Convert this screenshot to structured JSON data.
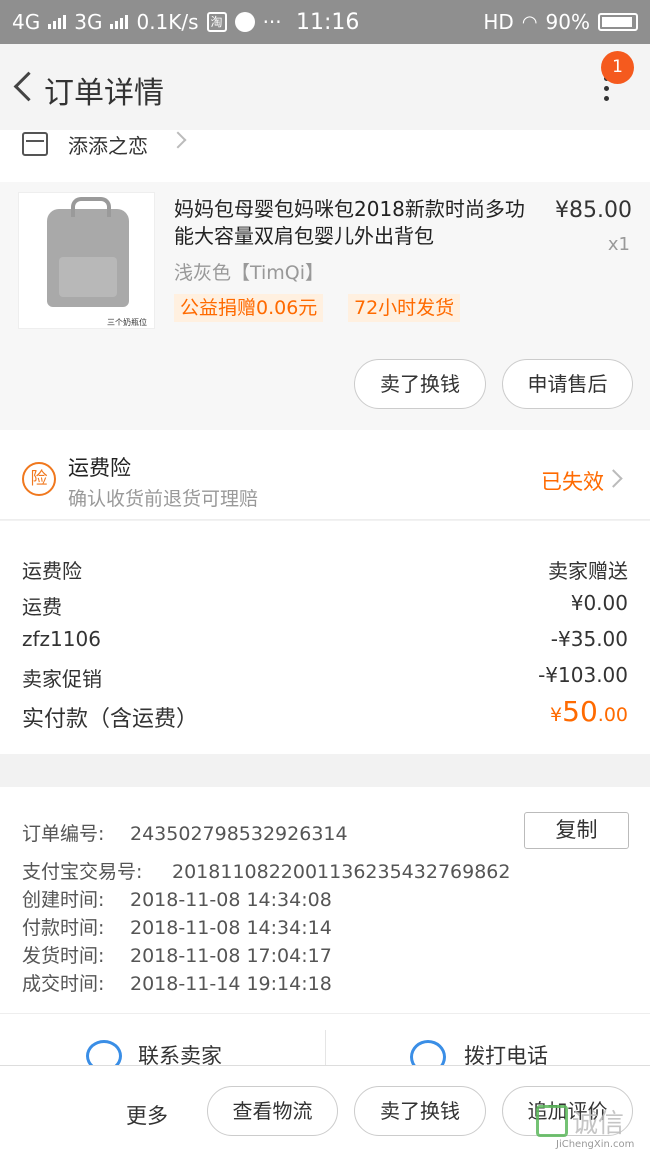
{
  "status_bar": {
    "network1": "4G",
    "network2": "3G",
    "speed": "0.1K/s",
    "taobao_glyph": "淘",
    "dots": "···",
    "time": "11:16",
    "hd": "HD",
    "battery": "90%"
  },
  "navbar": {
    "title": "订单详情",
    "badge_count": "1"
  },
  "shop": {
    "name": "添添之恋"
  },
  "product": {
    "title": "妈妈包母婴包妈咪包2018新款时尚多功能大容量双肩包婴儿外出背包",
    "price": "¥85.00",
    "qty": "x1",
    "sku": "浅灰色【TimQi】",
    "tag1": "公益捐赠0.06元",
    "tag2": "72小时发货",
    "thumb_caption": "三个奶瓶位",
    "btn_sell": "卖了换钱",
    "btn_aftersale": "申请售后"
  },
  "insurance": {
    "icon_label": "险",
    "title": "运费险",
    "subtitle": "确认收货前退货可理赔",
    "status": "已失效"
  },
  "costs": {
    "rows": [
      {
        "label": "运费险",
        "value": "卖家赠送"
      },
      {
        "label": "运费",
        "value": "¥0.00"
      },
      {
        "label": "zfz1106",
        "value": "-¥35.00"
      },
      {
        "label": "卖家促销",
        "value": "-¥103.00"
      }
    ],
    "total_label": "实付款（含运费）",
    "total_currency": "¥",
    "total_int": "50",
    "total_dec": ".00"
  },
  "order_info": {
    "order_no_label": "订单编号:",
    "order_no": "243502798532926314",
    "copy_label": "复制",
    "alipay_label": "支付宝交易号:",
    "alipay_no": "2018110822001136235432769862",
    "created_label": "创建时间:",
    "created": "2018-11-08 14:34:08",
    "paid_label": "付款时间:",
    "paid": "2018-11-08 14:34:14",
    "shipped_label": "发货时间:",
    "shipped": "2018-11-08 17:04:17",
    "done_label": "成交时间:",
    "done": "2018-11-14 19:14:18"
  },
  "contact": {
    "seller": "联系卖家",
    "phone": "拨打电话"
  },
  "bottom_bar": {
    "more": "更多",
    "logistics": "查看物流",
    "sell": "卖了换钱",
    "review": "追加评价"
  },
  "watermark": {
    "text": "诚信",
    "url": "JiChengXin.com"
  },
  "colors": {
    "accent": "#ff6a00",
    "badge": "#f55a1e",
    "link_blue": "#3a8ee6"
  }
}
